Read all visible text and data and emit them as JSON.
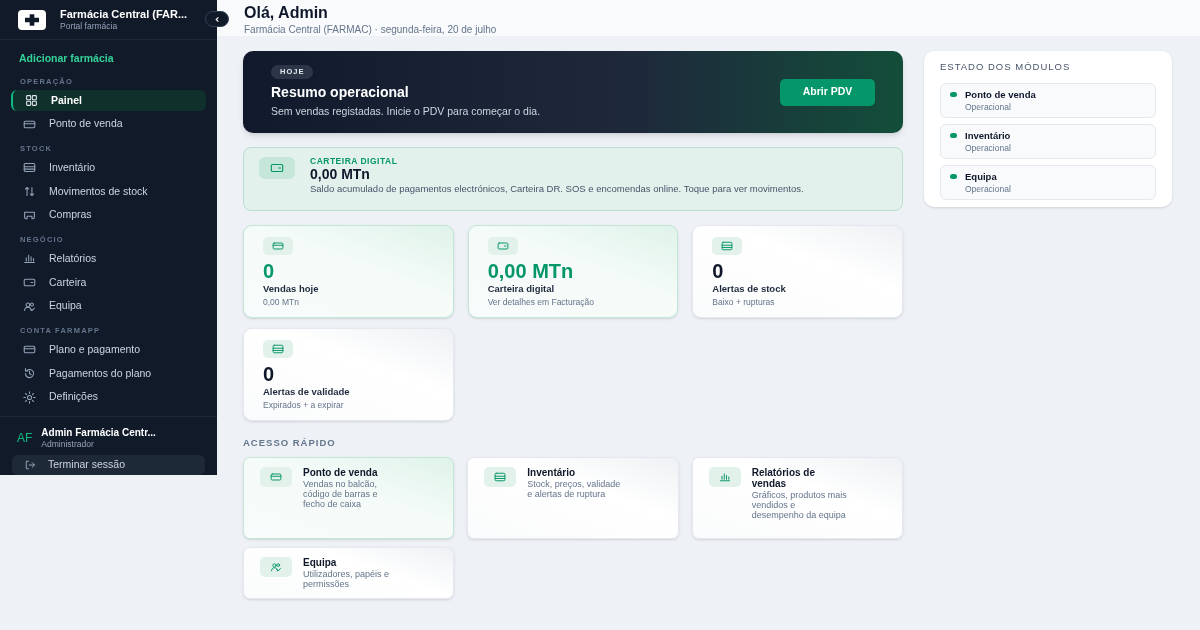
{
  "sidebar": {
    "brand": {
      "title": "Farmácia Central (FAR...",
      "subtitle": "Portal farmácia"
    },
    "add_link": "Adicionar farmácia",
    "sections": [
      {
        "heading": "OPERAÇÃO",
        "items": [
          {
            "label": "Painel",
            "selected": true
          },
          {
            "label": "Ponto de venda",
            "selected": false
          }
        ]
      },
      {
        "heading": "STOCK",
        "items": [
          {
            "label": "Inventário",
            "selected": false
          },
          {
            "label": "Movimentos de stock",
            "selected": false
          },
          {
            "label": "Compras",
            "selected": false
          }
        ]
      },
      {
        "heading": "NEGÓCIO",
        "items": [
          {
            "label": "Relatórios",
            "selected": false
          },
          {
            "label": "Carteira",
            "selected": false
          },
          {
            "label": "Equipa",
            "selected": false
          }
        ]
      },
      {
        "heading": "CONTA FARMAPP",
        "items": [
          {
            "label": "Plano e pagamento",
            "selected": false
          },
          {
            "label": "Pagamentos do plano",
            "selected": false
          },
          {
            "label": "Definições",
            "selected": false
          }
        ]
      }
    ],
    "user": {
      "initials": "AF",
      "name": "Admin Farmácia Centr...",
      "role": "Administrador"
    },
    "logout": "Terminar sessão"
  },
  "header": {
    "title": "Olá, Admin",
    "subtitle": "Farmácia Central (FARMAC) · segunda-feira, 20 de julho"
  },
  "hero": {
    "badge": "HOJE",
    "title": "Resumo operacional",
    "text": "Sem vendas registadas. Inicie o PDV para começar o dia.",
    "button": "Abrir PDV"
  },
  "wallet": {
    "label": "CARTEIRA DIGITAL",
    "amount": "0,00 MTn",
    "text": "Saldo acumulado de pagamentos electrónicos, Carteira DR. SOS e encomendas online. Toque para ver movimentos."
  },
  "stats": [
    {
      "value": "0",
      "label": "Vendas hoje",
      "detail": "0,00 MTn",
      "accent": true
    },
    {
      "value": "0,00 MTn",
      "label": "Carteira digital",
      "detail": "Ver detalhes em Facturação",
      "accent": true
    },
    {
      "value": "0",
      "label": "Alertas de stock",
      "detail": "Baixo + rupturas",
      "accent": false
    },
    {
      "value": "0",
      "label": "Alertas de validade",
      "detail": "Expirados + a expirar",
      "accent": false
    }
  ],
  "quick_access": {
    "heading": "ACESSO RÁPIDO",
    "items": [
      {
        "title": "Ponto de venda",
        "text": "Vendas no balcão, código de barras e fecho de caixa",
        "accent": true
      },
      {
        "title": "Inventário",
        "text": "Stock, preços, validade e alertas de ruptura",
        "accent": false
      },
      {
        "title": "Relatórios de vendas",
        "text": "Gráficos, produtos mais vendidos e desempenho da equipa",
        "accent": false
      },
      {
        "title": "Equipa",
        "text": "Utilizadores, papéis e permissões",
        "accent": false
      }
    ]
  },
  "modules": {
    "heading": "ESTADO DOS MÓDULOS",
    "items": [
      {
        "name": "Ponto de venda",
        "status": "Operacional",
        "color": "#059669"
      },
      {
        "name": "Inventário",
        "status": "Operacional",
        "color": "#059669"
      },
      {
        "name": "Equipa",
        "status": "Operacional",
        "color": "#059669"
      }
    ]
  }
}
